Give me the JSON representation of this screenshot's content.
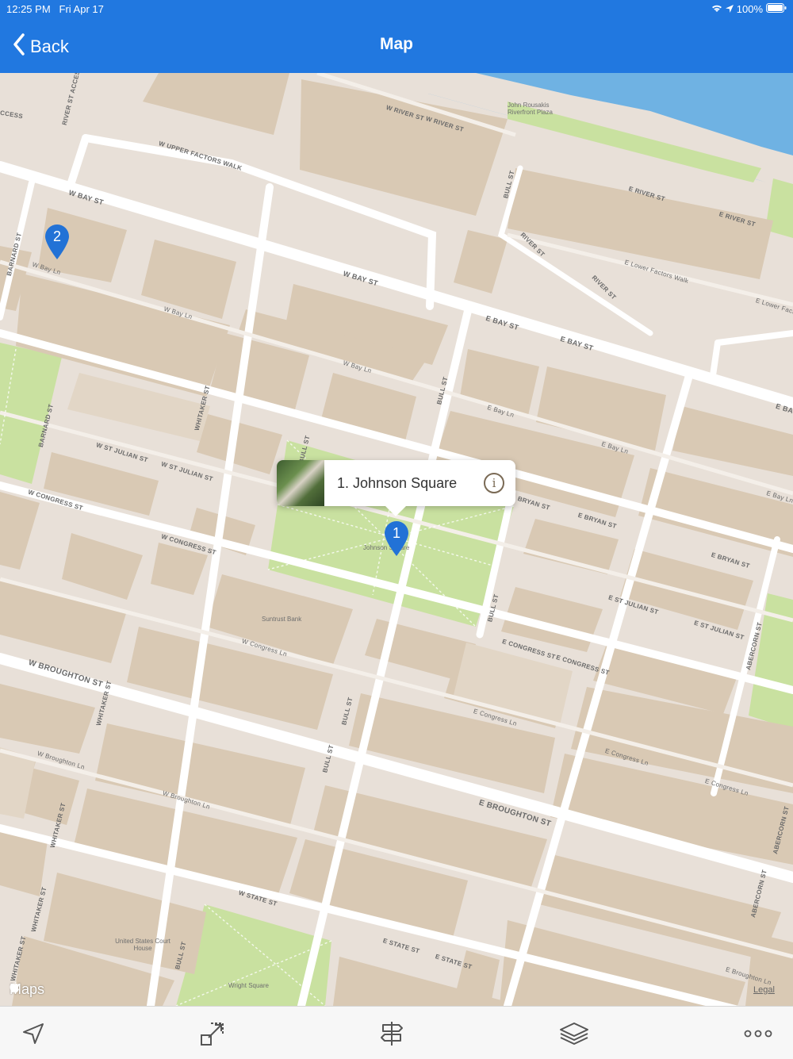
{
  "status_bar": {
    "time": "12:25 PM",
    "date": "Fri Apr 17",
    "battery": "100%"
  },
  "nav": {
    "back_label": "Back",
    "title": "Map"
  },
  "callout": {
    "name": "1. Johnson Square"
  },
  "pins": [
    {
      "label": "1"
    },
    {
      "label": "2"
    }
  ],
  "streets": {
    "w_bay_st_1": "W BAY ST",
    "w_bay_st_2": "W BAY ST",
    "e_bay_st_1": "E BAY ST",
    "e_bay_st_2": "E BAY ST",
    "e_bay_edge": "E BA",
    "w_upper_factors_walk": "W UPPER FACTORS WALK",
    "w_river_st": "W RIVER ST",
    "w_river_st_2": "W RIVER ST",
    "e_river_st_1": "E RIVER ST",
    "e_river_st_2": "E RIVER ST",
    "river_st_1": "RIVER ST",
    "river_st_2": "RIVER ST",
    "e_lower_factors_walk": "E Lower Factors Walk",
    "e_lower_factors_edge": "E Lower Factc",
    "w_bay_ln_1": "W Bay Ln",
    "w_bay_ln_2": "W Bay Ln",
    "w_bay_ln_3": "W Bay Ln",
    "e_bay_ln_1": "E Bay Ln",
    "e_bay_ln_2": "E Bay Ln",
    "e_bay_ln_3": "E Bay Ln",
    "w_st_julian_st_1": "W ST JULIAN ST",
    "w_st_julian_st_2": "W ST JULIAN ST",
    "e_st_julian_st_1": "E ST JULIAN ST",
    "e_st_julian_st_2": "E ST JULIAN ST",
    "w_congress_st_1": "W CONGRESS ST",
    "w_congress_st_2": "W CONGRESS ST",
    "e_congress_st_1": "E CONGRESS ST",
    "e_congress_st_2": "E CONGRESS ST",
    "w_congress_ln": "W Congress Ln",
    "e_congress_ln_1": "E Congress Ln",
    "e_congress_ln_2": "E Congress Ln",
    "e_congress_ln_3": "E Congress Ln",
    "w_broughton_st": "W BROUGHTON ST",
    "e_broughton_st": "E BROUGHTON ST",
    "w_broughton_ln_1": "W Broughton Ln",
    "w_broughton_ln_2": "W Broughton Ln",
    "e_broughton_ln": "E Broughton Ln",
    "e_bryan_st_1": "BRYAN ST",
    "e_bryan_st_2": "E BRYAN ST",
    "e_bryan_st_3": "E BRYAN ST",
    "w_state_st": "W STATE ST",
    "e_state_st_1": "E STATE ST",
    "e_state_st_2": "E STATE ST",
    "bull_st_1": "BULL ST",
    "bull_st_2": "BULL ST",
    "bull_st_3": "BULL ST",
    "bull_st_4": "BULL ST",
    "bull_st_5": "BULL ST",
    "bull_st_6": "BULL ST",
    "bull_st_7": "BULL ST",
    "whitaker_st_1": "WHITAKER ST",
    "whitaker_st_2": "WHITAKER ST",
    "whitaker_st_3": "WHITAKER ST",
    "whitaker_st_4": "WHITAKER ST",
    "whitaker_st_5": "WHITAKER ST",
    "barnard_st_1": "BARNARD ST",
    "barnard_st_2": "BARNARD ST",
    "abercorn_st_1": "ABERCORN ST",
    "abercorn_st_2": "ABERCORN ST",
    "abercorn_st_3": "ABERCORN ST",
    "river_st_access": "RIVER ST ACCESS",
    "access": "CCESS"
  },
  "pois": {
    "rousakis": "John Rousakis Riverfront Plaza",
    "johnson_square": "Johnson Square",
    "suntrust": "Suntrust Bank",
    "courthouse": "United States Court House",
    "wright_square": "Wright Square"
  },
  "map_footer": {
    "maps_logo": "Maps",
    "legal": "Legal"
  },
  "toolbar": {
    "icons": [
      "location-arrow",
      "zoom-extent",
      "directions-sign",
      "layers",
      "more"
    ]
  },
  "colors": {
    "nav_bar": "#2178e0",
    "map_bg": "#e8e0d8",
    "block": "#d9c9b4",
    "park": "#c9e1a0",
    "water": "#6fb2e3",
    "pin": "#2272d6"
  }
}
